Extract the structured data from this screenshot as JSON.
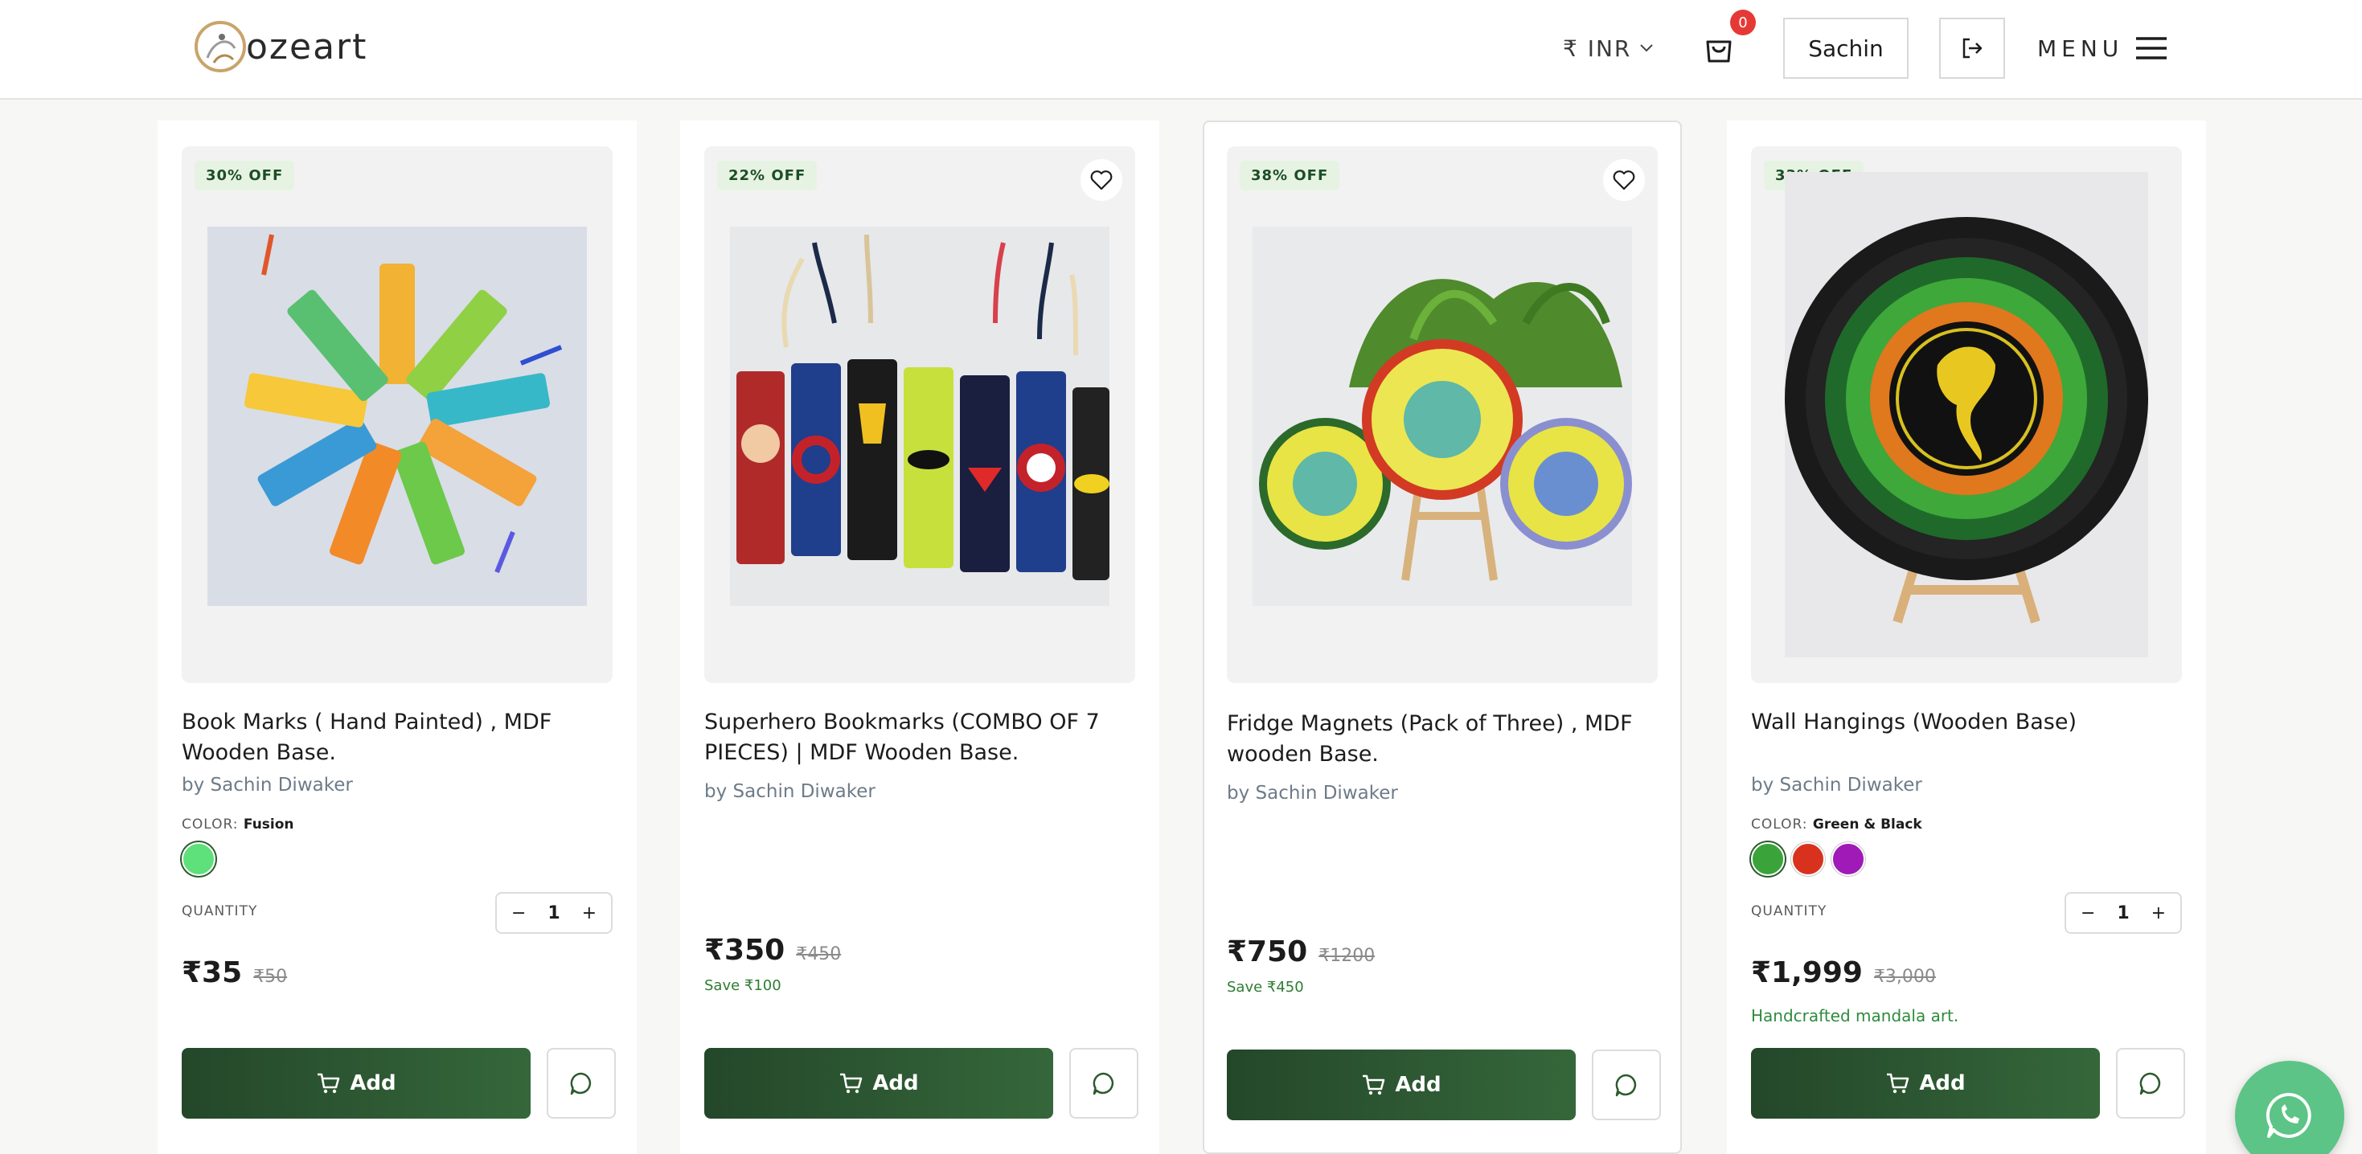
{
  "header": {
    "logo_text": "ozeart",
    "currency": "₹ INR",
    "cart_count": "0",
    "user_name": "Sachin",
    "menu_label": "MENU"
  },
  "labels": {
    "color": "COLOR:",
    "quantity": "QUANTITY",
    "add": "Add",
    "minus": "−",
    "plus": "+"
  },
  "products": [
    {
      "badge": "30% OFF",
      "title": "Book Marks ( Hand Painted) , MDF Wooden Base.",
      "byline": "by Sachin Diwaker",
      "color_value": "Fusion",
      "quantity": "1",
      "price": "₹35",
      "mrp": "₹50"
    },
    {
      "badge": "22% OFF",
      "title": "Superhero Bookmarks (COMBO OF 7 PIECES) | MDF Wooden Base.",
      "byline": "by Sachin Diwaker",
      "price": "₹350",
      "mrp": "₹450",
      "save": "Save ₹100"
    },
    {
      "badge": "38% OFF",
      "title": "Fridge Magnets (Pack of Three) , MDF wooden Base.",
      "byline": "by Sachin Diwaker",
      "price": "₹750",
      "mrp": "₹1200",
      "save": "Save ₹450"
    },
    {
      "badge": "33% OFF",
      "title": "Wall Hangings (Wooden Base)",
      "byline": "by Sachin Diwaker",
      "color_value": "Green & Black",
      "quantity": "1",
      "price": "₹1,999",
      "mrp": "₹3,000",
      "note": "Handcrafted mandala art."
    }
  ],
  "colors": {
    "brand_green": "#2c5a2e",
    "badge_bg": "#e6f3e3",
    "swatch_fusion": "#5ee07a",
    "swatch_green": "#3aa33a",
    "swatch_red": "#d8321e",
    "swatch_purple": "#a01ab8",
    "whatsapp": "#5cc486"
  }
}
